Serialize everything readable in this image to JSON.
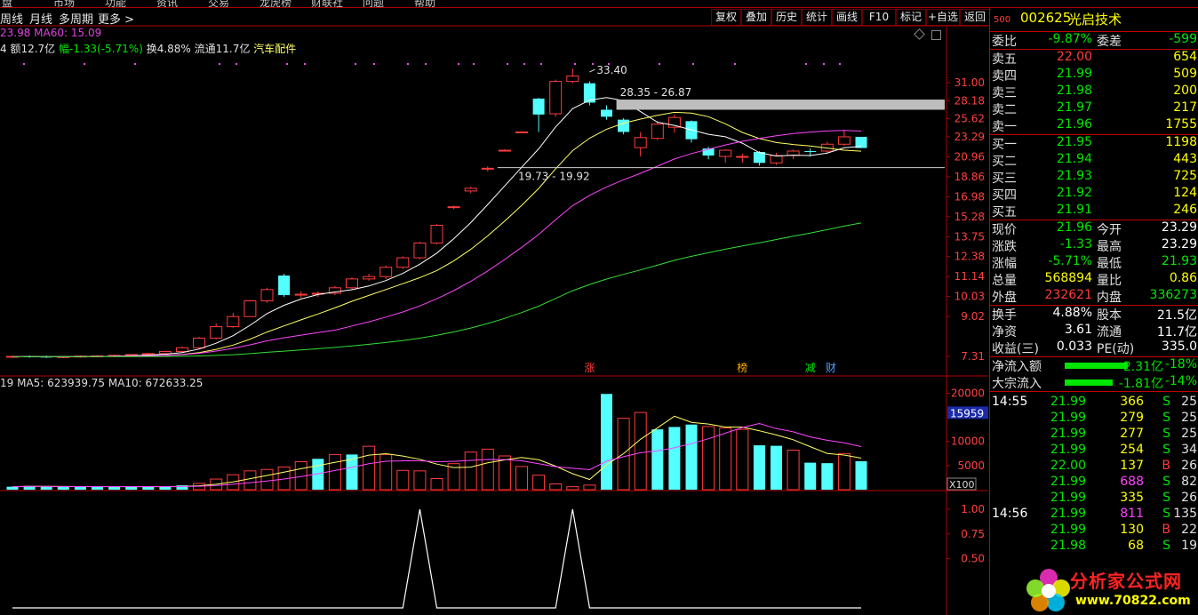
{
  "top_menu": [
    "盘",
    "市场",
    "功能",
    "资讯",
    "交易",
    "龙虎榜",
    "财联社",
    "问题",
    "帮助"
  ],
  "toolbar": {
    "period_items": [
      "周线",
      "月线",
      "多周期",
      "更多 >"
    ],
    "buttons": [
      "复权",
      "叠加",
      "历史",
      "统计",
      "画线",
      "F10",
      "标记",
      "+自选",
      "返回"
    ]
  },
  "info_lines": {
    "ma_line": "23.98   MA60: 15.09",
    "stat_prefix": "4 额12.7亿",
    "stat_change": "幅-1.33(-5.71%)",
    "stat_rest": "换4.88% 流通11.7亿",
    "stat_sector": "汽车配件"
  },
  "chart_data": [
    {
      "type": "candlestick",
      "title": "",
      "price_axis": [
        "31.00",
        "28.18",
        "25.62",
        "23.29",
        "20.96",
        "18.86",
        "16.98",
        "15.28",
        "13.75",
        "12.38",
        "11.14",
        "10.03",
        "9.02",
        "7.31"
      ],
      "candles": [
        {
          "o": 7.3,
          "h": 7.35,
          "l": 7.25,
          "c": 7.31
        },
        {
          "o": 7.31,
          "h": 7.35,
          "l": 7.26,
          "c": 7.3
        },
        {
          "o": 7.3,
          "h": 7.34,
          "l": 7.25,
          "c": 7.28
        },
        {
          "o": 7.28,
          "h": 7.32,
          "l": 7.24,
          "c": 7.3
        },
        {
          "o": 7.3,
          "h": 7.35,
          "l": 7.26,
          "c": 7.32
        },
        {
          "o": 7.32,
          "h": 7.36,
          "l": 7.27,
          "c": 7.33
        },
        {
          "o": 7.33,
          "h": 7.38,
          "l": 7.28,
          "c": 7.35
        },
        {
          "o": 7.35,
          "h": 7.4,
          "l": 7.3,
          "c": 7.38
        },
        {
          "o": 7.38,
          "h": 7.45,
          "l": 7.35,
          "c": 7.42
        },
        {
          "o": 7.42,
          "h": 7.52,
          "l": 7.4,
          "c": 7.5
        },
        {
          "o": 7.5,
          "h": 7.7,
          "l": 7.45,
          "c": 7.65
        },
        {
          "o": 7.65,
          "h": 8.1,
          "l": 7.6,
          "c": 8.05
        },
        {
          "o": 8.05,
          "h": 8.7,
          "l": 8.0,
          "c": 8.55
        },
        {
          "o": 8.55,
          "h": 9.2,
          "l": 8.5,
          "c": 9.02
        },
        {
          "o": 9.02,
          "h": 9.85,
          "l": 9.0,
          "c": 9.8
        },
        {
          "o": 9.8,
          "h": 10.5,
          "l": 9.7,
          "c": 10.4
        },
        {
          "o": 11.2,
          "h": 11.3,
          "l": 10.0,
          "c": 10.1
        },
        {
          "o": 10.1,
          "h": 10.3,
          "l": 9.95,
          "c": 10.15
        },
        {
          "o": 10.15,
          "h": 10.3,
          "l": 10.0,
          "c": 10.2
        },
        {
          "o": 10.2,
          "h": 10.6,
          "l": 10.1,
          "c": 10.5
        },
        {
          "o": 10.5,
          "h": 11.1,
          "l": 10.4,
          "c": 11.0
        },
        {
          "o": 11.0,
          "h": 11.3,
          "l": 10.9,
          "c": 11.14
        },
        {
          "o": 11.14,
          "h": 11.8,
          "l": 11.0,
          "c": 11.7
        },
        {
          "o": 11.7,
          "h": 12.4,
          "l": 11.6,
          "c": 12.3
        },
        {
          "o": 12.3,
          "h": 13.4,
          "l": 12.2,
          "c": 13.3
        },
        {
          "o": 13.3,
          "h": 14.7,
          "l": 13.2,
          "c": 14.6
        },
        {
          "o": 16.1,
          "h": 16.2,
          "l": 15.9,
          "c": 16.1
        },
        {
          "o": 17.5,
          "h": 17.9,
          "l": 17.3,
          "c": 17.75
        },
        {
          "o": 19.73,
          "h": 19.92,
          "l": 19.4,
          "c": 19.73
        },
        {
          "o": 21.7,
          "h": 21.8,
          "l": 21.6,
          "c": 21.7
        },
        {
          "o": 23.9,
          "h": 24.0,
          "l": 23.8,
          "c": 23.9
        },
        {
          "o": 28.5,
          "h": 28.6,
          "l": 23.9,
          "c": 26.2
        },
        {
          "o": 26.3,
          "h": 31.5,
          "l": 25.9,
          "c": 31.2
        },
        {
          "o": 31.2,
          "h": 33.4,
          "l": 30.9,
          "c": 32.1
        },
        {
          "o": 30.9,
          "h": 31.2,
          "l": 27.5,
          "c": 27.9
        },
        {
          "o": 26.87,
          "h": 27.5,
          "l": 25.5,
          "c": 25.9
        },
        {
          "o": 25.5,
          "h": 25.7,
          "l": 23.6,
          "c": 23.9
        },
        {
          "o": 22.0,
          "h": 23.9,
          "l": 21.0,
          "c": 23.2
        },
        {
          "o": 23.1,
          "h": 25.3,
          "l": 22.9,
          "c": 24.9
        },
        {
          "o": 24.5,
          "h": 26.2,
          "l": 23.8,
          "c": 25.8
        },
        {
          "o": 25.3,
          "h": 25.4,
          "l": 22.6,
          "c": 23.0
        },
        {
          "o": 21.9,
          "h": 22.1,
          "l": 20.7,
          "c": 21.1
        },
        {
          "o": 21.0,
          "h": 21.8,
          "l": 20.3,
          "c": 21.7
        },
        {
          "o": 21.0,
          "h": 21.3,
          "l": 20.3,
          "c": 21.0
        },
        {
          "o": 21.5,
          "h": 21.6,
          "l": 20.0,
          "c": 20.3
        },
        {
          "o": 20.3,
          "h": 21.4,
          "l": 20.1,
          "c": 21.1
        },
        {
          "o": 21.1,
          "h": 21.8,
          "l": 20.7,
          "c": 21.6
        },
        {
          "o": 21.6,
          "h": 21.9,
          "l": 21.0,
          "c": 21.5
        },
        {
          "o": 21.6,
          "h": 22.7,
          "l": 21.3,
          "c": 22.4
        },
        {
          "o": 22.4,
          "h": 24.1,
          "l": 22.2,
          "c": 23.29
        },
        {
          "o": 23.29,
          "h": 23.29,
          "l": 21.93,
          "c": 21.96
        }
      ],
      "annotations": [
        "33.40",
        "28.35 - 26.87",
        "19.73 - 19.92"
      ],
      "markers": [
        "涨",
        "榜",
        "减",
        "财"
      ]
    },
    {
      "type": "bar",
      "title": "",
      "legend": "19  MA5: 623939.75   MA10: 672633.25",
      "axis": [
        "20000",
        "15959",
        "10000",
        "5000"
      ],
      "axis_unit": "X100",
      "values": [
        620,
        780,
        620,
        620,
        620,
        620,
        620,
        620,
        620,
        620,
        900,
        1300,
        2200,
        3100,
        3900,
        4200,
        4700,
        5800,
        6400,
        7300,
        7300,
        9000,
        7300,
        4000,
        3900,
        2300,
        5400,
        7800,
        8400,
        7000,
        4800,
        3000,
        1200,
        620,
        950,
        19850,
        14800,
        16000,
        12500,
        13000,
        13500,
        13100,
        12800,
        12500,
        9200,
        9100,
        8200,
        5600,
        5500,
        7500,
        5900,
        5500,
        5690
      ],
      "up_flags": [
        0,
        0,
        0,
        0,
        0,
        0,
        0,
        0,
        0,
        0,
        0,
        1,
        1,
        1,
        1,
        1,
        1,
        1,
        0,
        1,
        0,
        1,
        1,
        1,
        1,
        1,
        1,
        1,
        1,
        1,
        1,
        1,
        1,
        1,
        1,
        0,
        1,
        1,
        0,
        0,
        0,
        1,
        1,
        1,
        0,
        0,
        1,
        0,
        0,
        1,
        0,
        1,
        1,
        0
      ]
    },
    {
      "type": "line",
      "title": "",
      "axis": [
        "1.00",
        "0.75",
        "0.50"
      ],
      "values": [
        0,
        0,
        0,
        0,
        0,
        0,
        0,
        0,
        0,
        0,
        0,
        0,
        0,
        0,
        0,
        0,
        0,
        0,
        0,
        0,
        0,
        0,
        0,
        0,
        1,
        0,
        0,
        0,
        0,
        0,
        0,
        0,
        0,
        1,
        0,
        0,
        0,
        0,
        0,
        0,
        0,
        0,
        0,
        0,
        0,
        0,
        0,
        0,
        0,
        0,
        0,
        0,
        0,
        0
      ]
    }
  ],
  "quote": {
    "header_small": "500",
    "code": "002625",
    "name": "光启技术",
    "rows_top": [
      {
        "l1": "委比",
        "v1": "-9.87%",
        "l2": "委差",
        "v2": "-599",
        "c1": "dn",
        "c2": "dn"
      }
    ],
    "sell": [
      {
        "label": "卖五",
        "price": "22.00",
        "vol": "654",
        "pc": "up"
      },
      {
        "label": "卖四",
        "price": "21.99",
        "vol": "509",
        "pc": "dn"
      },
      {
        "label": "卖三",
        "price": "21.98",
        "vol": "200",
        "pc": "dn"
      },
      {
        "label": "卖二",
        "price": "21.97",
        "vol": "217",
        "pc": "dn"
      },
      {
        "label": "卖一",
        "price": "21.96",
        "vol": "1755",
        "pc": "dn"
      }
    ],
    "buy": [
      {
        "label": "买一",
        "price": "21.95",
        "vol": "1198",
        "pc": "dn"
      },
      {
        "label": "买二",
        "price": "21.94",
        "vol": "443",
        "pc": "dn"
      },
      {
        "label": "买三",
        "price": "21.93",
        "vol": "725",
        "pc": "dn"
      },
      {
        "label": "买四",
        "price": "21.92",
        "vol": "124",
        "pc": "dn"
      },
      {
        "label": "买五",
        "price": "21.91",
        "vol": "246",
        "pc": "dn"
      }
    ],
    "stats": [
      {
        "l1": "现价",
        "v1": "21.96",
        "c1": "dn",
        "l2": "今开",
        "v2": "23.29",
        "c2": "wh"
      },
      {
        "l1": "涨跌",
        "v1": "-1.33",
        "c1": "dn",
        "l2": "最高",
        "v2": "23.29",
        "c2": "wh"
      },
      {
        "l1": "涨幅",
        "v1": "-5.71%",
        "c1": "dn",
        "l2": "最低",
        "v2": "21.93",
        "c2": "dn"
      },
      {
        "l1": "总量",
        "v1": "568894",
        "c1": "yl",
        "l2": "量比",
        "v2": "0.86",
        "c2": "yl"
      },
      {
        "l1": "外盘",
        "v1": "232621",
        "c1": "up",
        "l2": "内盘",
        "v2": "336273",
        "c2": "dn"
      }
    ],
    "fund": [
      {
        "l1": "换手",
        "v1": "4.88%",
        "l2": "股本",
        "v2": "21.5亿"
      },
      {
        "l1": "净资",
        "v1": "3.61",
        "l2": "流通",
        "v2": "11.7亿"
      },
      {
        "l1": "收益(三)",
        "v1": "0.033",
        "l2": "PE(动)",
        "v2": "335.0"
      }
    ],
    "flows": [
      {
        "label": "净流入额",
        "value": "-2.31亿",
        "pct": "-18%",
        "bar": 0.84
      },
      {
        "label": "大宗流入",
        "value": "-1.81亿",
        "pct": "-14%",
        "bar": 0.64
      }
    ],
    "ticks": [
      {
        "time": "14:55",
        "price": "21.99",
        "vol": "366",
        "bs": "S",
        "n": "25",
        "pc": "dn",
        "vc": "yl"
      },
      {
        "time": "",
        "price": "21.99",
        "vol": "279",
        "bs": "S",
        "n": "25",
        "pc": "dn",
        "vc": "yl"
      },
      {
        "time": "",
        "price": "21.99",
        "vol": "277",
        "bs": "S",
        "n": "25",
        "pc": "dn",
        "vc": "yl"
      },
      {
        "time": "",
        "price": "21.99",
        "vol": "254",
        "bs": "S",
        "n": "34",
        "pc": "dn",
        "vc": "yl"
      },
      {
        "time": "",
        "price": "22.00",
        "vol": "137",
        "bs": "B",
        "n": "26",
        "pc": "dn",
        "vc": "yl"
      },
      {
        "time": "",
        "price": "21.99",
        "vol": "688",
        "bs": "S",
        "n": "82",
        "pc": "dn",
        "vc": "pk"
      },
      {
        "time": "",
        "price": "21.99",
        "vol": "335",
        "bs": "S",
        "n": "26",
        "pc": "dn",
        "vc": "yl"
      },
      {
        "time": "14:56",
        "price": "21.99",
        "vol": "811",
        "bs": "S",
        "n": "135",
        "pc": "dn",
        "vc": "pk"
      },
      {
        "time": "",
        "price": "21.99",
        "vol": "130",
        "bs": "B",
        "n": "22",
        "pc": "dn",
        "vc": "yl"
      },
      {
        "time": "",
        "price": "21.98",
        "vol": "68",
        "bs": "S",
        "n": "19",
        "pc": "dn",
        "vc": "yl"
      }
    ]
  },
  "watermark": {
    "text": "分析家公式网",
    "url": "www.70822.com"
  }
}
